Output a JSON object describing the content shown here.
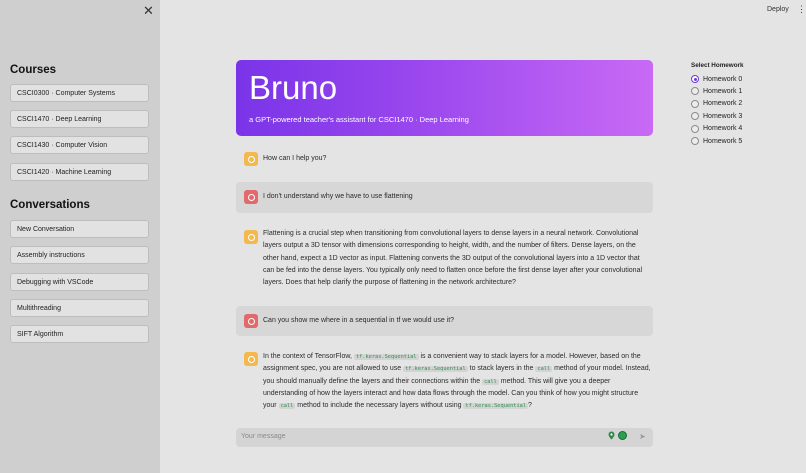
{
  "app": {
    "deploy_label": "Deploy",
    "menu_glyph": "⋮",
    "close_glyph": "✕"
  },
  "sidebar": {
    "courses_title": "Courses",
    "courses": [
      "CSCI0300 · Computer Systems",
      "CSCI1470 · Deep Learning",
      "CSCI1430 · Computer Vision",
      "CSCI1420 · Machine Learning"
    ],
    "conversations_title": "Conversations",
    "conversations": [
      "New Conversation",
      "Assembly instructions",
      "Debugging with VSCode",
      "Multithreading",
      "SIFT Algorithm"
    ]
  },
  "hero": {
    "title": "Bruno",
    "subtitle": "a GPT-powered teacher's assistant for CSCI1470 · Deep Learning",
    "gradient": [
      "#7a34e8",
      "#c86af5"
    ]
  },
  "messages": [
    {
      "role": "bot",
      "text": "How can I help you?"
    },
    {
      "role": "user",
      "text": "I don't understand why we have to use flattening"
    },
    {
      "role": "bot",
      "text": "Flattening is a crucial step when transitioning from convolutional layers to dense layers in a neural network. Convolutional layers output a 3D tensor with dimensions corresponding to height, width, and the number of filters. Dense layers, on the other hand, expect a 1D vector as input. Flattening converts the 3D output of the convolutional layers into a 1D vector that can be fed into the dense layers. You typically only need to flatten once before the first dense layer after your convolutional layers. Does that help clarify the purpose of flattening in the network architecture?"
    },
    {
      "role": "user",
      "text": "Can you show me where in a sequential in tf we would use it?"
    },
    {
      "role": "bot",
      "parts": [
        "In the context of TensorFlow, ",
        {
          "code": "tf.keras.Sequential"
        },
        " is a convenient way to stack layers for a model. However, based on the assignment spec, you are not allowed to use ",
        {
          "code": "tf.keras.Sequential"
        },
        " to stack layers in the ",
        {
          "code": "call"
        },
        " method of your model. Instead, you should manually define the layers and their connections within the ",
        {
          "code": "call"
        },
        " method. This will give you a deeper understanding of how the layers interact and how data flows through the model. Can you think of how you might structure your ",
        {
          "code": "call"
        },
        " method to include the necessary layers without using ",
        {
          "code": "tf.keras.Sequential"
        },
        "?"
      ]
    }
  ],
  "input": {
    "placeholder": "Your message",
    "send_glyph": "➤"
  },
  "homework": {
    "title": "Select Homework",
    "options": [
      "Homework 0",
      "Homework 1",
      "Homework 2",
      "Homework 3",
      "Homework 4",
      "Homework 5"
    ],
    "selected": "Homework 0",
    "accent": "#6d3ad8"
  }
}
